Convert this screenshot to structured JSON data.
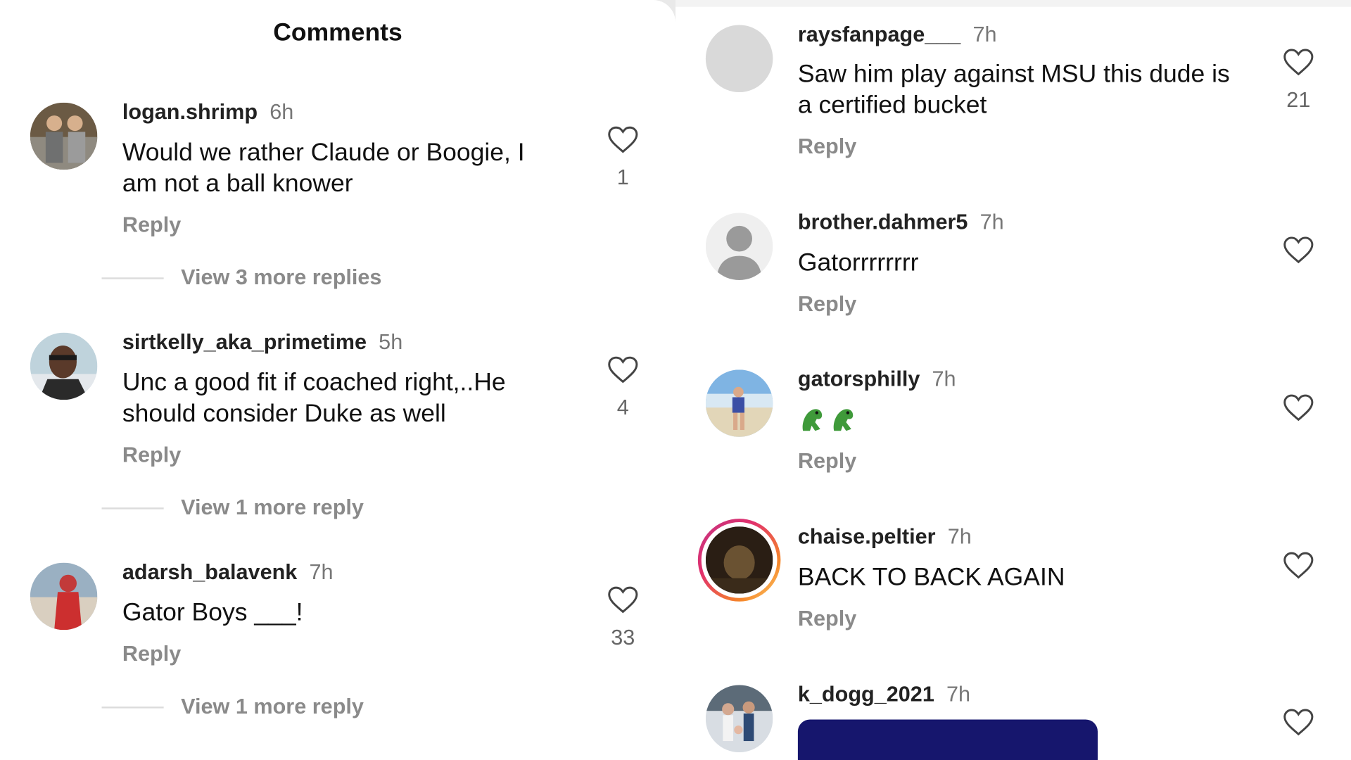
{
  "header": {
    "title": "Comments"
  },
  "colors": {
    "navy": "#16166d",
    "story_ring_start": "#e1306c",
    "story_ring_end": "#f58529"
  },
  "left_comments": [
    {
      "username": "logan.shrimp",
      "time": "6h",
      "text": "Would we rather Claude or Boogie, I am not a ball knower",
      "reply": "Reply",
      "likes": "1",
      "view_more": "View 3 more replies"
    },
    {
      "username": "sirtkelly_aka_primetime",
      "time": "5h",
      "text": "Unc a good fit if coached right,..He should consider Duke as well",
      "reply": "Reply",
      "likes": "4",
      "view_more": "View 1 more reply"
    },
    {
      "username": "adarsh_balavenk",
      "time": "7h",
      "text": "Gator Boys ___!",
      "reply": "Reply",
      "likes": "33",
      "view_more": "View 1 more reply"
    }
  ],
  "right_comments": [
    {
      "username": "raysfanpage___",
      "time": "7h",
      "text": "Saw him play against MSU this dude is a certified bucket",
      "reply": "Reply",
      "likes": "21"
    },
    {
      "username": "brother.dahmer5",
      "time": "7h",
      "text": "Gatorrrrrrrr",
      "reply": "Reply",
      "likes": ""
    },
    {
      "username": "gatorsphilly",
      "time": "7h",
      "text": "",
      "emoji": [
        "crocodile-emoji",
        "crocodile-emoji"
      ],
      "reply": "Reply",
      "likes": ""
    },
    {
      "username": "chaise.peltier",
      "time": "7h",
      "text": "BACK TO BACK AGAIN",
      "reply": "Reply",
      "likes": ""
    },
    {
      "username": "k_dogg_2021",
      "time": "7h",
      "text": "",
      "reply": "",
      "likes": ""
    }
  ]
}
